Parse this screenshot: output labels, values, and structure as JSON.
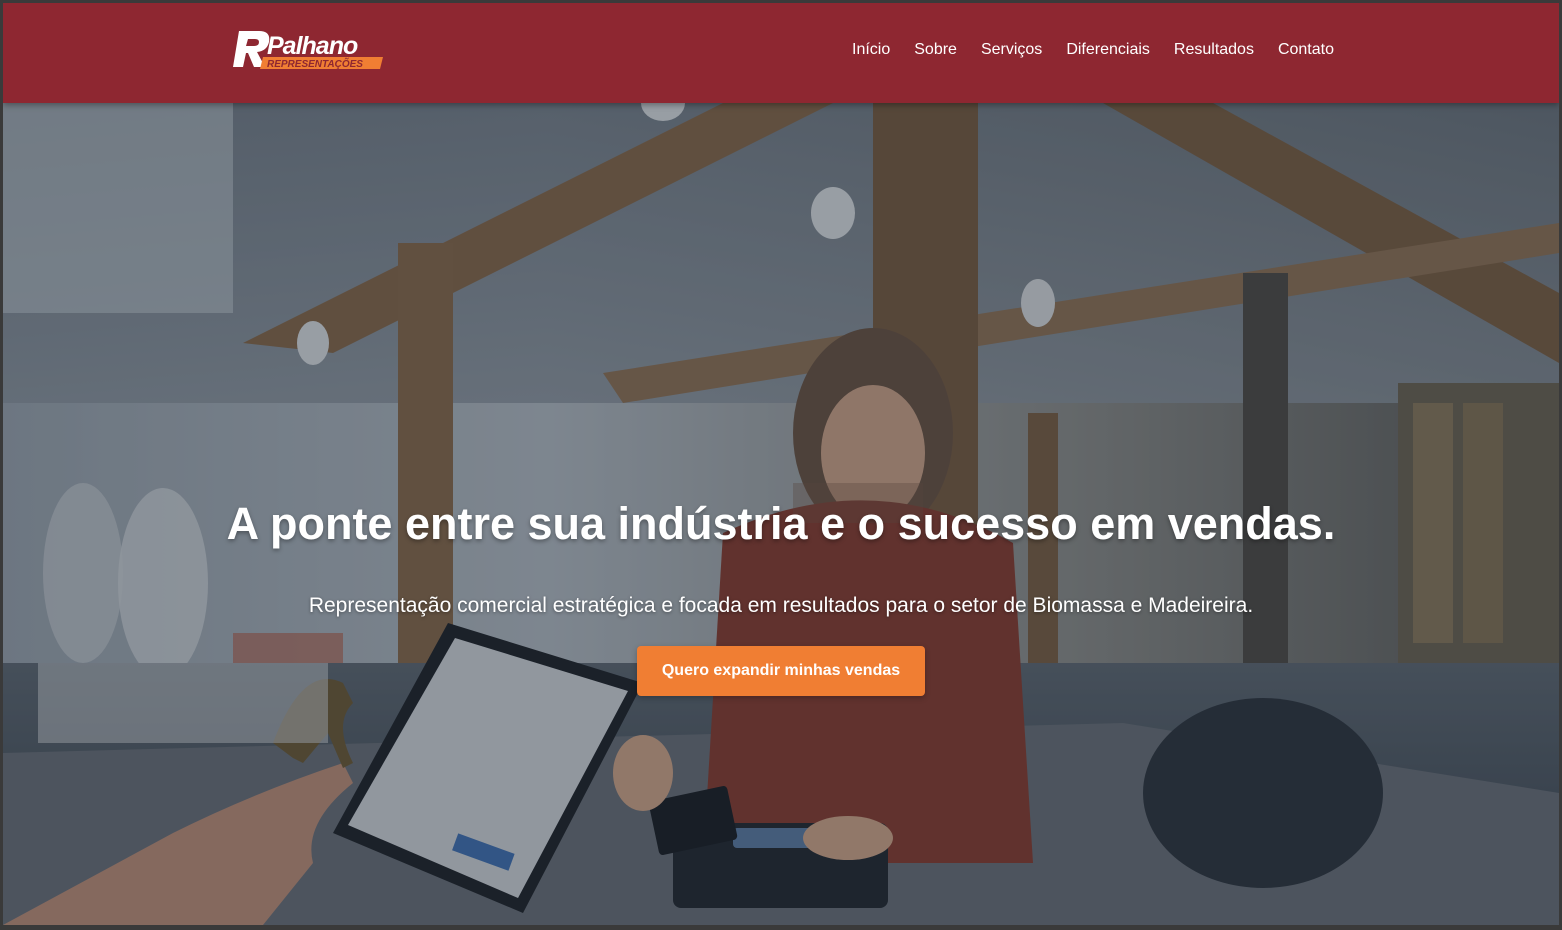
{
  "header": {
    "logo": {
      "letter": "R",
      "name": "Palhano",
      "tagline": "REPRESENTAÇÕES",
      "colors": {
        "primary": "#ffffff",
        "accent": "#f07e33"
      }
    },
    "nav": [
      {
        "label": "Início"
      },
      {
        "label": "Sobre"
      },
      {
        "label": "Serviços"
      },
      {
        "label": "Diferenciais"
      },
      {
        "label": "Resultados"
      },
      {
        "label": "Contato"
      }
    ]
  },
  "hero": {
    "title": "A ponte entre sua indústria e o sucesso em vendas.",
    "subtitle": "Representação comercial estratégica e focada em resultados para o setor de Biomassa e Madeireira.",
    "cta_label": "Quero expandir minhas vendas",
    "background_icon": "office-photo"
  },
  "colors": {
    "header_bg": "#8e2731",
    "cta_bg": "#f07e33",
    "text": "#ffffff"
  }
}
